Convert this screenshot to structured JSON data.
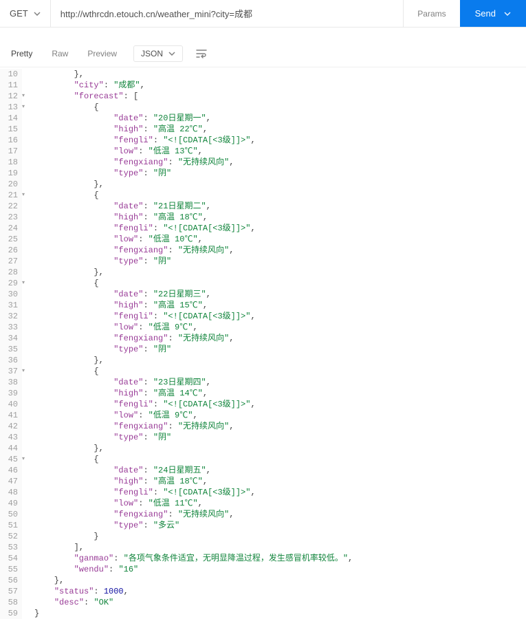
{
  "method": "GET",
  "url": "http://wthrcdn.etouch.cn/weather_mini?city=成都",
  "params_btn": "Params",
  "send_btn": "Send",
  "tabs": {
    "pretty": "Pretty",
    "raw": "Raw",
    "preview": "Preview",
    "format": "JSON"
  },
  "line_numbers": [
    "10",
    "11",
    "12",
    "13",
    "14",
    "15",
    "16",
    "17",
    "18",
    "19",
    "20",
    "21",
    "22",
    "23",
    "24",
    "25",
    "26",
    "27",
    "28",
    "29",
    "30",
    "31",
    "32",
    "33",
    "34",
    "35",
    "36",
    "37",
    "38",
    "39",
    "40",
    "41",
    "42",
    "43",
    "44",
    "45",
    "46",
    "47",
    "48",
    "49",
    "50",
    "51",
    "52",
    "53",
    "54",
    "55",
    "56",
    "57",
    "58",
    "59"
  ],
  "fold_lines": [
    "12",
    "13",
    "21",
    "29",
    "37",
    "45"
  ],
  "response": {
    "city": "成都",
    "forecast": [
      {
        "date": "20日星期一",
        "high": "高温 22℃",
        "fengli": "<![CDATA[<3级]]>",
        "low": "低温 13℃",
        "fengxiang": "无持续风向",
        "type": "阴"
      },
      {
        "date": "21日星期二",
        "high": "高温 18℃",
        "fengli": "<![CDATA[<3级]]>",
        "low": "低温 10℃",
        "fengxiang": "无持续风向",
        "type": "阴"
      },
      {
        "date": "22日星期三",
        "high": "高温 15℃",
        "fengli": "<![CDATA[<3级]]>",
        "low": "低温 9℃",
        "fengxiang": "无持续风向",
        "type": "阴"
      },
      {
        "date": "23日星期四",
        "high": "高温 14℃",
        "fengli": "<![CDATA[<3级]]>",
        "low": "低温 9℃",
        "fengxiang": "无持续风向",
        "type": "阴"
      },
      {
        "date": "24日星期五",
        "high": "高温 18℃",
        "fengli": "<![CDATA[<3级]]>",
        "low": "低温 11℃",
        "fengxiang": "无持续风向",
        "type": "多云"
      }
    ],
    "ganmao": "各项气象条件适宜，无明显降温过程，发生感冒机率较低。",
    "wendu": "16",
    "status": 1000,
    "desc": "OK"
  }
}
